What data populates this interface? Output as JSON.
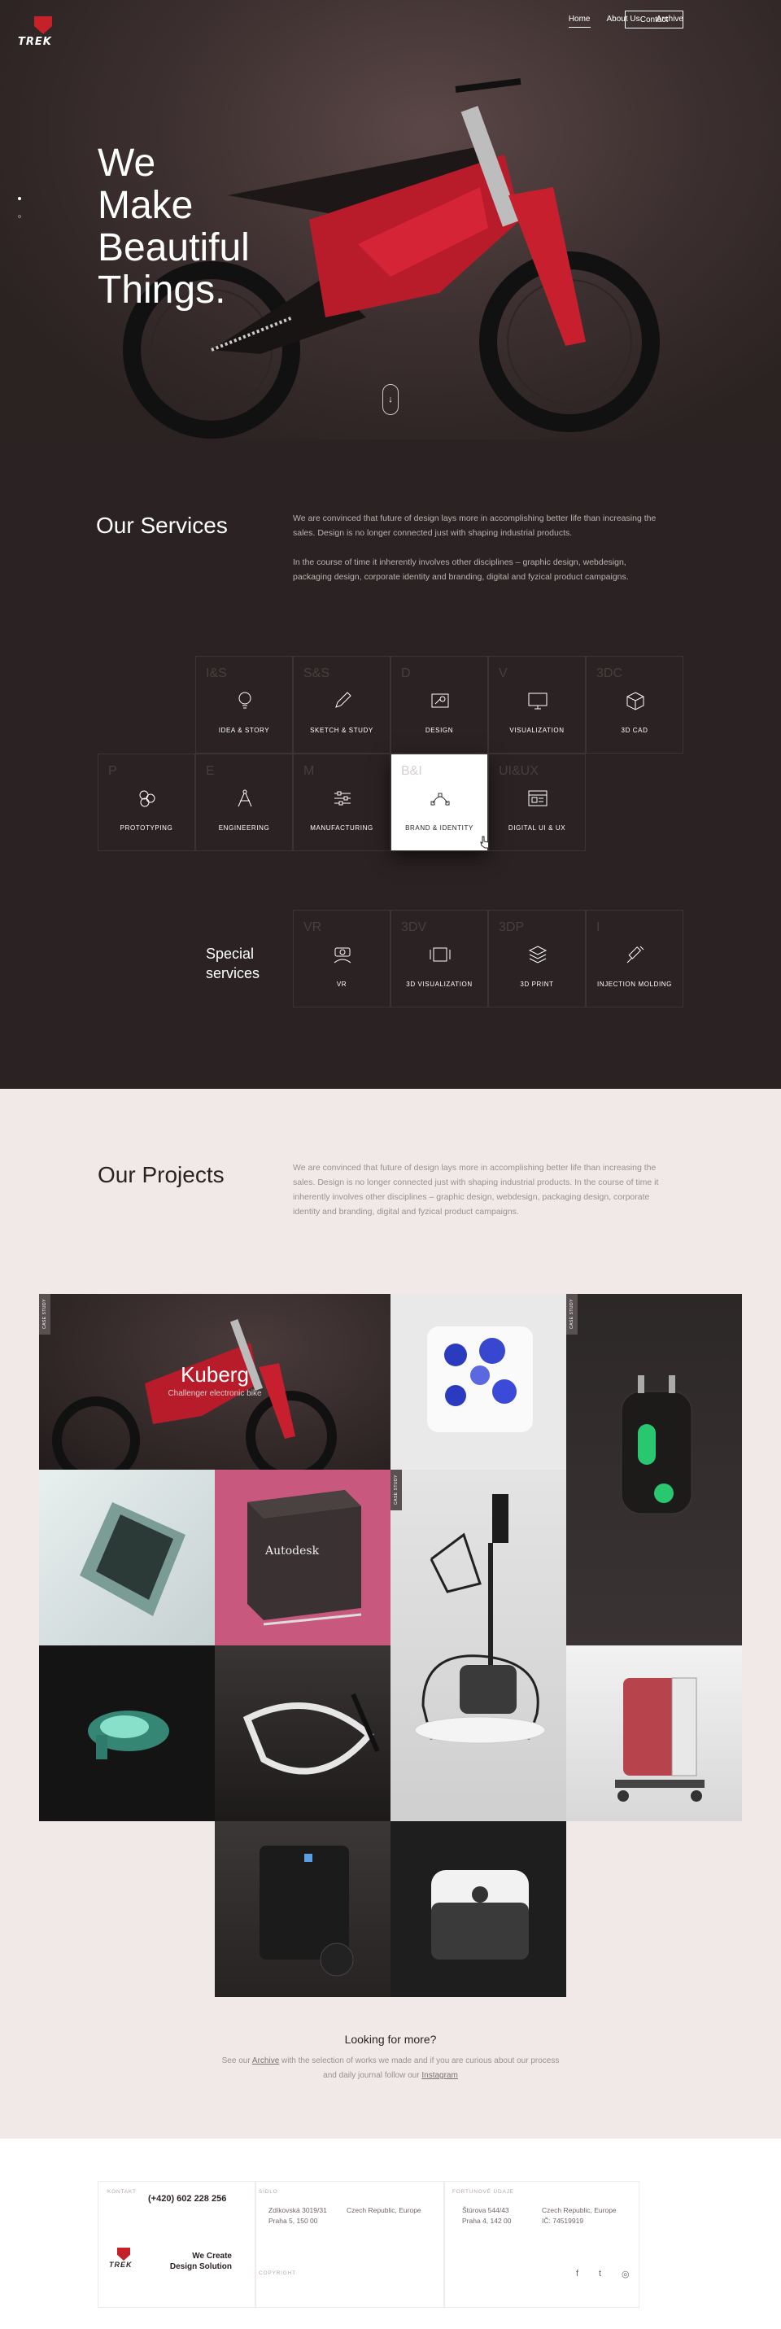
{
  "header": {
    "logo_text": "TREK",
    "nav": [
      "Home",
      "About Us",
      "Archive"
    ],
    "contact_label": "Contact"
  },
  "hero": {
    "title": "We\nMake\nBeautiful\nThings.",
    "scroll_icon": "arrow-down-icon"
  },
  "services": {
    "title": "Our Services",
    "text1": "We are convinced that future of design lays more in accomplishing better life than increasing the sales. Design is no longer connected just with shaping industrial products.",
    "text2": "In the course of time it inherently involves other disciplines – graphic design, webdesign, packaging design, corporate identity and branding, digital and fyzical product campaigns.",
    "items": [
      {
        "letters": "I&S",
        "label": "IDEA & STORY",
        "icon": "lightbulb-icon"
      },
      {
        "letters": "S&S",
        "label": "SKETCH & STUDY",
        "icon": "pencil-icon"
      },
      {
        "letters": "D",
        "label": "DESIGN",
        "icon": "design-icon"
      },
      {
        "letters": "V",
        "label": "VISUALIZATION",
        "icon": "monitor-icon"
      },
      {
        "letters": "3DC",
        "label": "3D CAD",
        "icon": "cube-icon"
      },
      {
        "letters": "P",
        "label": "PROTOTYPING",
        "icon": "circles-icon"
      },
      {
        "letters": "E",
        "label": "ENGINEERING",
        "icon": "compass-icon"
      },
      {
        "letters": "M",
        "label": "MANUFACTURING",
        "icon": "sliders-icon"
      },
      {
        "letters": "B&I",
        "label": "BRAND & IDENTITY",
        "icon": "vector-icon"
      },
      {
        "letters": "UI&UX",
        "label": "DIGITAL UI & UX",
        "icon": "browser-icon"
      }
    ],
    "special_title": "Special\nservices",
    "special": [
      {
        "letters": "VR",
        "label": "VR",
        "icon": "vr-icon"
      },
      {
        "letters": "3DV",
        "label": "3D VISUALIZATION",
        "icon": "frame-icon"
      },
      {
        "letters": "3DP",
        "label": "3D PRINT",
        "icon": "layers-icon"
      },
      {
        "letters": "I",
        "label": "INJECTION MOLDING",
        "icon": "syringe-icon"
      }
    ]
  },
  "projects": {
    "title": "Our Projects",
    "text": "We are convinced that future of design lays more in accomplishing better life than increasing the sales. Design is no longer connected just with shaping industrial products. In the course of time it inherently involves other disciplines – graphic design, webdesign, packaging design, corporate identity and branding, digital and fyzical product campaigns.",
    "badge": "CASE STUDY",
    "featured_name": "Kuberg",
    "featured_sub": "Challenger electronic bike",
    "autodesk_label": "Autodesk",
    "more_title": "Looking for more?",
    "more_pre": "See our ",
    "more_link1": "Archive",
    "more_mid": " with the selection of works we made and if you are curious about our process",
    "more_mid2": "and daily journal follow our ",
    "more_link2": "Instagram"
  },
  "footer": {
    "kontakt": "KONTAKT",
    "phone": "(+420) 602 228 256",
    "sidlo": "SÍDLO",
    "sidlo_addr1": "Zdíkovská 3019/31",
    "sidlo_addr2": "Praha 5, 150 00",
    "sidlo_country": "Czech Republic, Europe",
    "office": "FORTUNOVÉ ÚDAJE",
    "office_addr1": "Štúrova 544/43",
    "office_addr2": "Praha 4, 142 00",
    "office_country": "Czech Republic, Europe",
    "office_ic": "IČ: 74519919",
    "slogan": "We Create Design Solution",
    "copyright": "COPYRIGHT",
    "social": [
      "f",
      "t",
      "◎"
    ]
  }
}
